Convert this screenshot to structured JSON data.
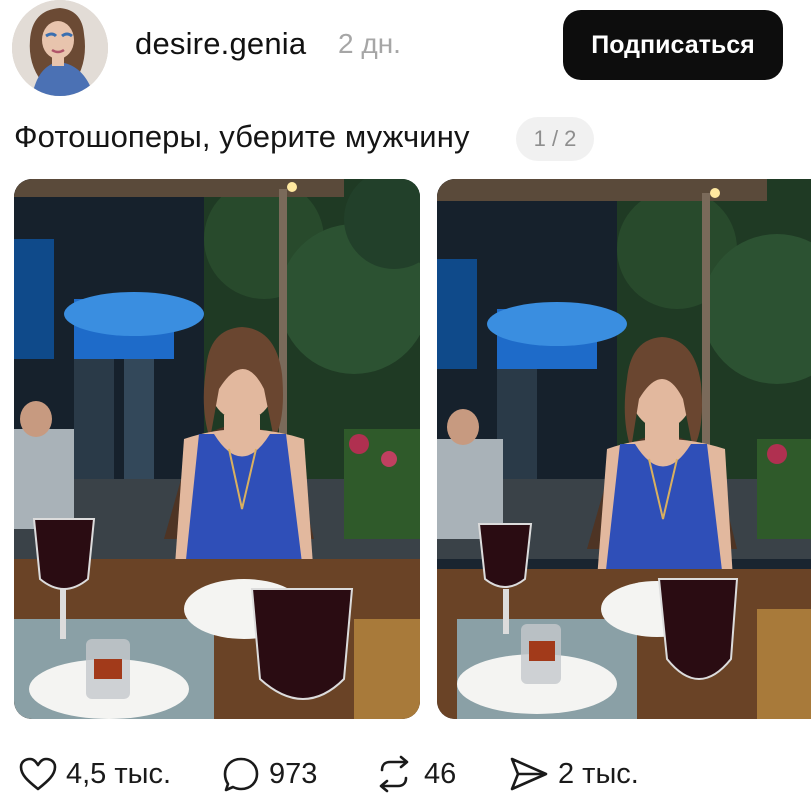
{
  "header": {
    "username": "desire.genia",
    "time_ago": "2 дн.",
    "subscribe_label": "Подписаться",
    "avatar_alt": "avatar"
  },
  "post": {
    "caption": "Фотошоперы, уберите мужчину",
    "carousel_counter": "1 / 2",
    "photos": [
      "photo-1",
      "photo-2"
    ]
  },
  "actions": {
    "likes": "4,5 тыс.",
    "comments": "973",
    "reposts": "46",
    "shares": "2 тыс."
  },
  "colors": {
    "button_bg": "#0d0d0d",
    "badge_bg": "#f1f1f1",
    "muted_text": "#a6a6a6"
  },
  "icons": {
    "like": "heart-icon",
    "comment": "comment-bubble-icon",
    "repost": "repost-icon",
    "share": "send-icon"
  }
}
